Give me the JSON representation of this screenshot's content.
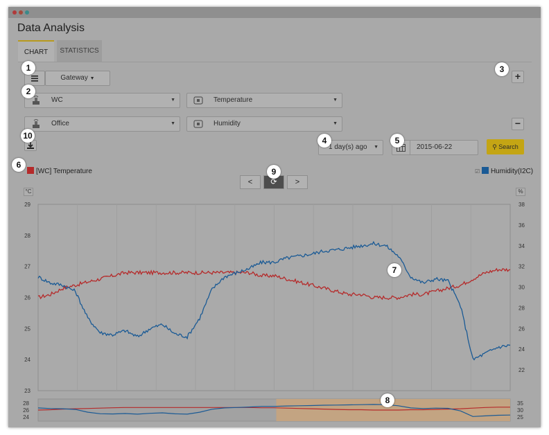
{
  "app": {
    "title": "Data Analysis"
  },
  "tabs": [
    {
      "label": "CHART",
      "active": true
    },
    {
      "label": "STATISTICS",
      "active": false
    }
  ],
  "toolbar": {
    "gateway_label": "Gateway",
    "add_label": "+",
    "remove_label": "−"
  },
  "rows": [
    {
      "location": "WC",
      "sensor": "Temperature"
    },
    {
      "location": "Office",
      "sensor": "Humidity"
    }
  ],
  "filters": {
    "range_label": "1 day(s) ago",
    "date_value": "2015-06-22",
    "search_label": "Search"
  },
  "legend": {
    "left": "[WC] Temperature",
    "right": "Humidity(I2C)"
  },
  "nav": {
    "prev": "<",
    "next": ">"
  },
  "callouts": [
    "1",
    "2",
    "3",
    "4",
    "5",
    "6",
    "7",
    "8",
    "9",
    "10"
  ],
  "colors": {
    "temperature": "#b52a2a",
    "humidity": "#1a5a95",
    "accent": "#c4a514",
    "selection": "#c9a47c"
  },
  "chart_data": {
    "type": "line",
    "left_axis": {
      "unit": "°C",
      "ylim": [
        23,
        29
      ],
      "ticks": [
        "29",
        "28",
        "27",
        "26",
        "25",
        "24",
        "23"
      ]
    },
    "right_axis": {
      "unit": "%",
      "ylim": [
        20,
        38
      ],
      "ticks": [
        "38",
        "36",
        "34",
        "32",
        "30",
        "28",
        "26",
        "24",
        "22"
      ]
    },
    "series": [
      {
        "name": "[WC] Temperature",
        "axis": "left",
        "values": [
          26.0,
          26.1,
          26.3,
          26.4,
          26.5,
          26.6,
          26.7,
          26.8,
          26.8,
          26.8,
          26.8,
          26.8,
          26.8,
          26.8,
          26.8,
          26.8,
          26.8,
          26.8,
          26.7,
          26.7,
          26.6,
          26.5,
          26.4,
          26.3,
          26.2,
          26.1,
          26.1,
          26.0,
          26.0,
          26.0,
          26.1,
          26.1,
          26.2,
          26.3,
          26.4,
          26.6,
          26.8,
          26.9,
          26.9
        ]
      },
      {
        "name": "Humidity(I2C)",
        "axis": "right",
        "values": [
          31.0,
          30.4,
          30.2,
          29.6,
          27.0,
          25.6,
          25.4,
          25.8,
          25.2,
          26.0,
          26.4,
          25.5,
          25.2,
          27.0,
          29.8,
          31.0,
          31.4,
          31.8,
          32.4,
          32.4,
          32.8,
          33.0,
          33.2,
          33.5,
          33.6,
          33.8,
          34.0,
          34.2,
          34.0,
          33.0,
          31.0,
          30.4,
          30.8,
          30.6,
          28.2,
          23.0,
          23.6,
          24.2,
          24.4
        ]
      }
    ],
    "navigator": {
      "left_ticks": [
        "28",
        "26",
        "24"
      ],
      "right_ticks": [
        "35",
        "30",
        "25"
      ],
      "selection_range": [
        0.5,
        1.0
      ]
    }
  }
}
